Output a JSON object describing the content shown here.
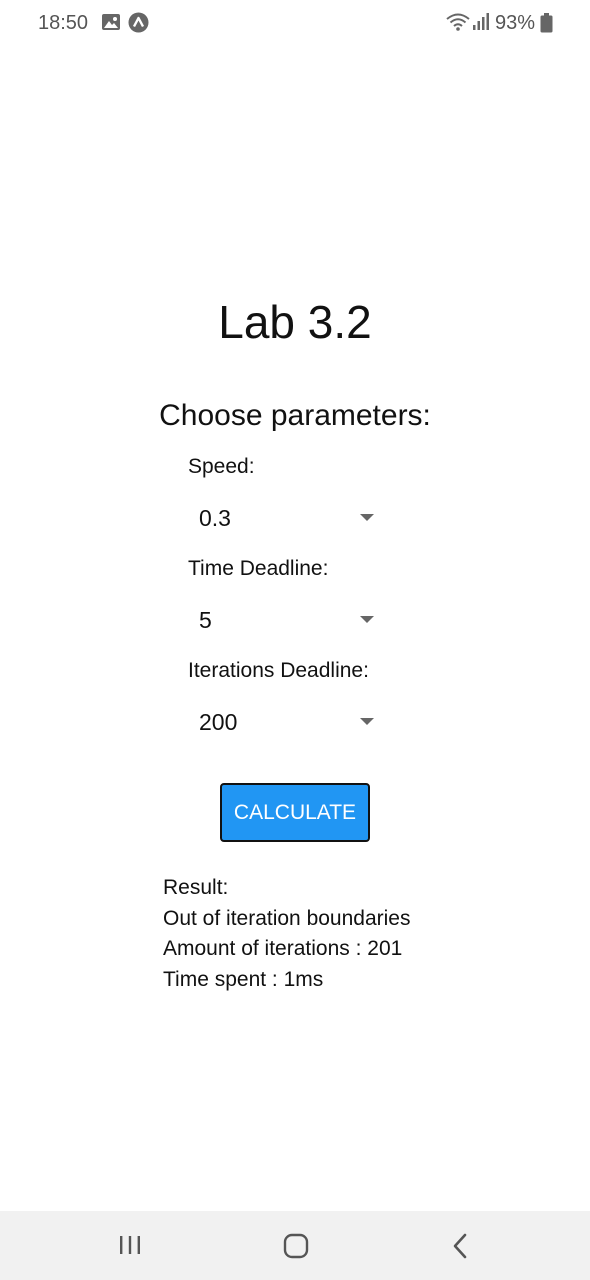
{
  "status_bar": {
    "time": "18:50",
    "battery_percent": "93%",
    "icons": [
      "gallery-icon",
      "app-badge-icon",
      "wifi-icon",
      "signal-icon",
      "battery-icon"
    ]
  },
  "page": {
    "title": "Lab 3.2",
    "section_title": "Choose parameters:"
  },
  "params": {
    "speed": {
      "label": "Speed:",
      "value": "0.3"
    },
    "time_deadline": {
      "label": "Time Deadline:",
      "value": "5"
    },
    "iterations_deadline": {
      "label": "Iterations Deadline:",
      "value": "200"
    }
  },
  "actions": {
    "calculate_label": "CALCULATE"
  },
  "result": {
    "heading": "Result:",
    "status": "Out of iteration boundaries",
    "iterations": "Amount of iterations : 201",
    "time_spent": "Time spent : 1ms"
  },
  "colors": {
    "accent": "#2196f3",
    "nav_background": "#f1f1f1",
    "status_text": "#555555"
  }
}
